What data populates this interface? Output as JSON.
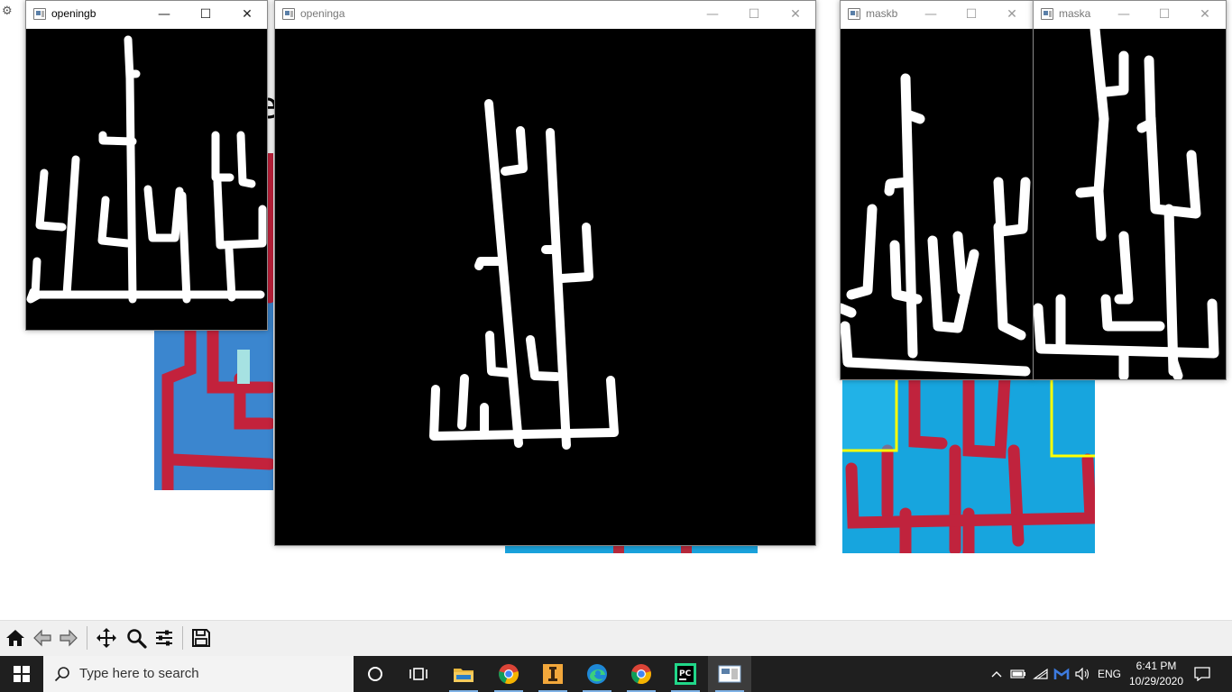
{
  "windows": {
    "openingb": {
      "title": "openingb"
    },
    "openinga": {
      "title": "openinga"
    },
    "maskb": {
      "title": "maskb"
    },
    "maska": {
      "title": "maska"
    }
  },
  "window_buttons": {
    "minimize": "—",
    "maximize": "☐",
    "close": "✕"
  },
  "background": {
    "partial_text": "e"
  },
  "toolbar": {
    "items": [
      "home-icon",
      "back-arrow-icon",
      "forward-arrow-icon",
      "pan-icon",
      "zoom-icon",
      "configure-subplots-icon",
      "save-icon"
    ]
  },
  "taskbar": {
    "search_placeholder": "Type here to search",
    "apps": [
      "cortana-icon",
      "task-view-icon",
      "file-explorer-icon",
      "chrome-icon",
      "app-icon",
      "edge-icon",
      "chrome-icon-2",
      "pycharm-icon",
      "python-window-icon"
    ],
    "language": "ENG",
    "time": "6:41 PM",
    "date": "10/29/2020"
  },
  "colors": {
    "taskbar_bg": "#1f1f1f",
    "pipe_red": "#c8203c",
    "board_blue": "#1f9ad6",
    "highlight_yellow": "#ffff00"
  }
}
